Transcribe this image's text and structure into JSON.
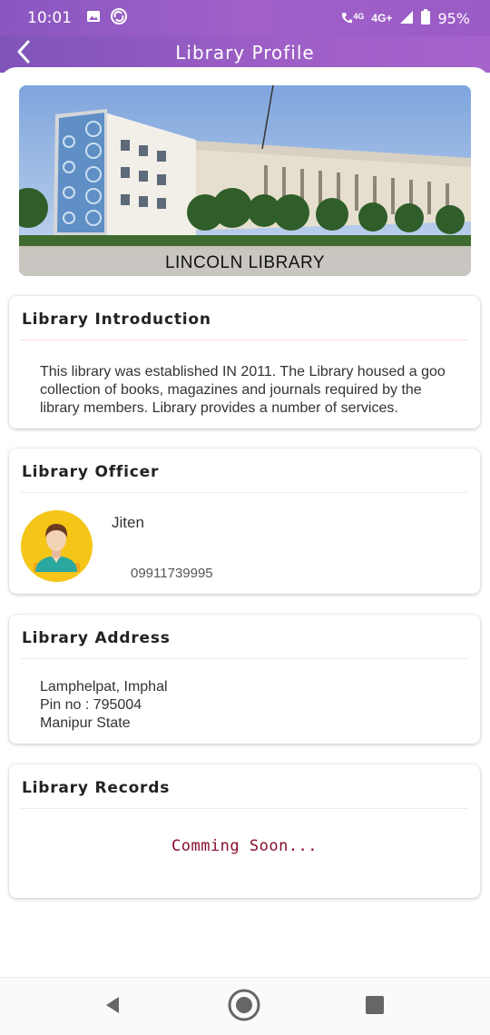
{
  "status_bar": {
    "time": "10:01",
    "network": "4G",
    "network2": "4G+",
    "battery": "95%",
    "icons": [
      "image-icon",
      "sync-icon",
      "volte-call-icon",
      "signal-icon",
      "battery-icon"
    ]
  },
  "app_bar": {
    "title": "Library Profile",
    "back_icon": "chevron-left-icon"
  },
  "hero": {
    "caption": "LINCOLN LIBRARY"
  },
  "introduction": {
    "title": "Library Introduction",
    "lines": [
      "This library was established IN 2011. The Library housed a goo",
      "collection of books, magazines and journals required by the",
      "library members. Library provides a number of services."
    ]
  },
  "officer": {
    "title": "Library Officer",
    "name": "Jiten",
    "phone": "09911739995",
    "avatar": "person-avatar"
  },
  "address": {
    "title": "Library Address",
    "lines": [
      "Lamphelpat, Imphal",
      "Pin no : 795004",
      "Manipur State"
    ]
  },
  "records": {
    "title": "Library Records",
    "status": "Comming Soon..."
  },
  "nav_bar": {
    "icons": [
      "back-triangle-icon",
      "home-circle-icon",
      "recents-square-icon"
    ]
  },
  "colors": {
    "accent": "#9d5ec6",
    "records_text": "#8b0e2e",
    "avatar_bg": "#f5c518"
  }
}
